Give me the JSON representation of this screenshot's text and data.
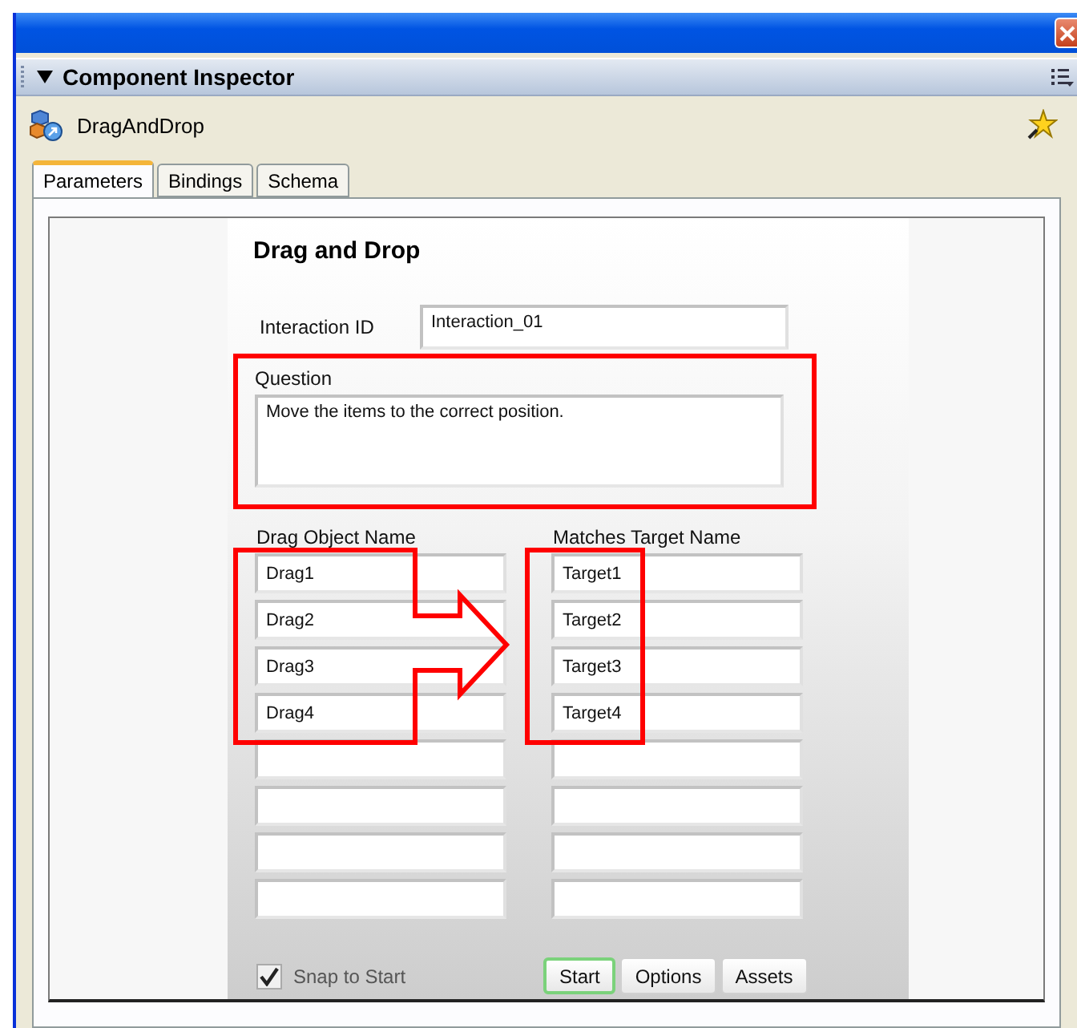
{
  "panel": {
    "title": "Component Inspector",
    "expanded": true
  },
  "component": {
    "name": "DragAndDrop"
  },
  "tabs": [
    {
      "label": "Parameters",
      "selected": true
    },
    {
      "label": "Bindings",
      "selected": false
    },
    {
      "label": "Schema",
      "selected": false
    }
  ],
  "form": {
    "title": "Drag and Drop",
    "interaction_id": {
      "label": "Interaction ID",
      "value": "Interaction_01"
    },
    "question": {
      "label": "Question",
      "value": "Move the items to the correct position."
    },
    "columns": [
      "Drag Object Name",
      "Matches Target Name"
    ],
    "rows": [
      {
        "drag": "Drag1",
        "target": "Target1"
      },
      {
        "drag": "Drag2",
        "target": "Target2"
      },
      {
        "drag": "Drag3",
        "target": "Target3"
      },
      {
        "drag": "Drag4",
        "target": "Target4"
      },
      {},
      {},
      {},
      {}
    ],
    "snap": {
      "label": "Snap to Start",
      "checked": true
    },
    "buttons": [
      {
        "label": "Start",
        "selected": true
      },
      {
        "label": "Options",
        "selected": false
      },
      {
        "label": "Assets",
        "selected": false
      }
    ]
  }
}
